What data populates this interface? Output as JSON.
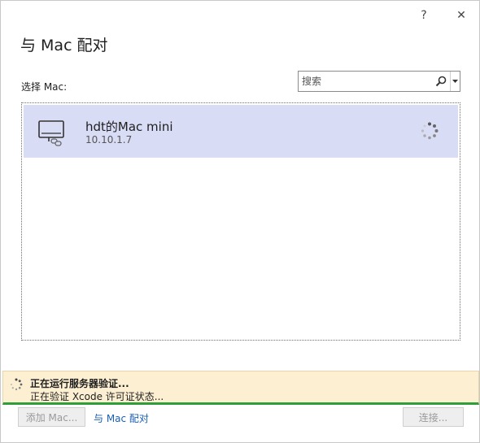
{
  "window": {
    "help_label": "?",
    "close_label": "✕"
  },
  "dialog": {
    "title": "与 Mac 配对",
    "select_label": "选择 Mac:"
  },
  "search": {
    "placeholder": "搜索",
    "value": ""
  },
  "mac_list": {
    "items": [
      {
        "name": "hdt的Mac mini",
        "ip": "10.10.1.7",
        "icon": "monitor-link-icon",
        "status": "loading"
      }
    ]
  },
  "status": {
    "title": "正在运行服务器验证...",
    "subtitle": "正在验证 Xcode 许可证状态...",
    "accent_color": "#2e9e3a",
    "background_color": "#fdf0d2"
  },
  "footer": {
    "add_label": "添加 Mac...",
    "pair_link": "与 Mac 配对",
    "connect_label": "连接..."
  },
  "colors": {
    "selection": "#d8dcf5",
    "link": "#1a5fb4"
  }
}
